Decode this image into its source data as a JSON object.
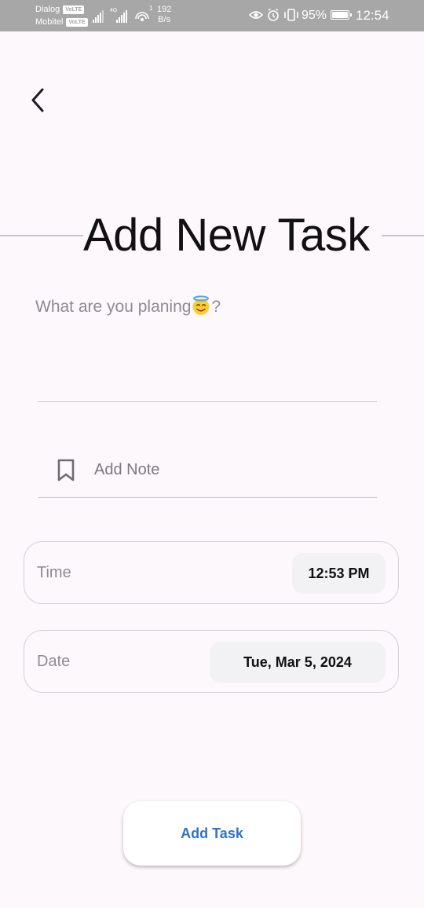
{
  "status_bar": {
    "carrier_1": "Dialog",
    "carrier_2": "Mobitel",
    "volte": "VoLTE",
    "network_type": "4G",
    "upload_count": "1",
    "speed_value": "192",
    "speed_unit": "B/s",
    "battery": "95%",
    "time": "12:54"
  },
  "header": {
    "back_icon": "chevron-left-icon",
    "title_light": "Add New ",
    "title_bold": "Task"
  },
  "task_input": {
    "placeholder": "What are you planing",
    "placeholder_suffix": "?",
    "emoji": "smiling-face-with-halo"
  },
  "note": {
    "icon": "bookmark-icon",
    "label": "Add Note"
  },
  "time_picker": {
    "label": "Time",
    "value": "12:53 PM"
  },
  "date_picker": {
    "label": "Date",
    "value": "Tue, Mar 5, 2024"
  },
  "actions": {
    "add_task_label": "Add Task"
  },
  "colors": {
    "background": "#fdf8fc",
    "status_bar": "#a7a7a7",
    "accent": "#2f72c6",
    "field_fill": "#f2f1f3"
  }
}
